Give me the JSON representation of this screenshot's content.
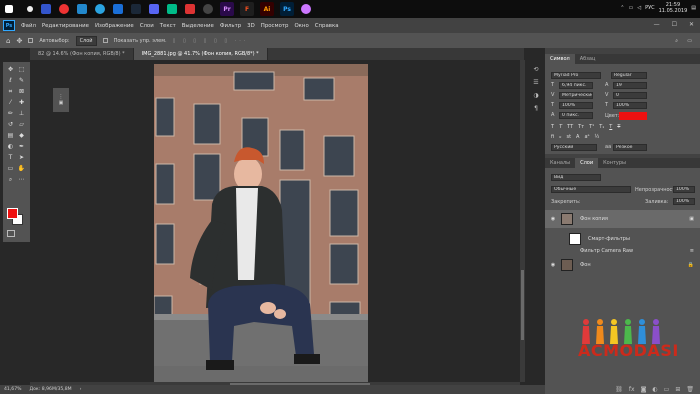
{
  "taskbar": {
    "time": "21:59",
    "date": "11.05.2019",
    "lang": "РУС",
    "apps": [
      {
        "icon": "premiere-icon",
        "label": "Pr",
        "bg": "#2a0a4a",
        "fg": "#d98cff"
      },
      {
        "icon": "figma-icon",
        "label": "F",
        "bg": "#1e1e1e",
        "fg": "#f24e1e"
      },
      {
        "icon": "illustrator-icon",
        "label": "Ai",
        "bg": "#330000",
        "fg": "#ff9a00"
      },
      {
        "icon": "photoshop-icon",
        "label": "Ps",
        "bg": "#001e36",
        "fg": "#31a8ff"
      }
    ]
  },
  "menubar": {
    "logo": "Ps",
    "items": [
      "Файл",
      "Редактирование",
      "Изображение",
      "Слои",
      "Текст",
      "Выделение",
      "Фильтр",
      "3D",
      "Просмотр",
      "Окно",
      "Справка"
    ]
  },
  "optionsbar": {
    "autoselect_label": "Автовыбор:",
    "autoselect_value": "Слой",
    "transform_label": "Показать упр. элем."
  },
  "doctabs": [
    {
      "label": "82 @ 14.6% (Фон копия, RGB/8) *",
      "active": false
    },
    {
      "label": "IMG_2881.jpg @ 41.7% (Фон копия, RGB/8*) *",
      "active": true
    }
  ],
  "statusbar": {
    "zoom": "41,67%",
    "doc": "Док: 8,96M/35,8M"
  },
  "character_panel": {
    "tabs": [
      "Символ",
      "Абзац"
    ],
    "font": "Myriad Pro",
    "style": "Regular",
    "size": "6,94 пикс.",
    "leading": "19",
    "tracking_label": "Метрические",
    "tracking": "0",
    "vscale": "100%",
    "hscale": "100%",
    "baseline": "0 пикс.",
    "color_label": "Цвет:",
    "color": "#ee1111",
    "language": "Русский",
    "aa": "Резкое"
  },
  "layers_panel": {
    "tabs": [
      "Каналы",
      "Слои",
      "Контуры"
    ],
    "filter": "Вид",
    "blend": "Обычные",
    "opacity_label": "Непрозрачность:",
    "opacity": "100%",
    "lock_label": "Закрепить:",
    "fill_label": "Заливка:",
    "fill": "100%",
    "layers": [
      {
        "name": "Фон копия",
        "selected": true,
        "thumb": "#8a7a70"
      },
      {
        "name": "Смарт-фильтры",
        "selected": false,
        "thumb": "#ffffff"
      },
      {
        "name": "Фильтр Camera Raw",
        "selected": false,
        "thumb": ""
      },
      {
        "name": "Фон",
        "selected": false,
        "thumb": "#6d5d52"
      }
    ]
  },
  "watermark": "ACMODASI"
}
